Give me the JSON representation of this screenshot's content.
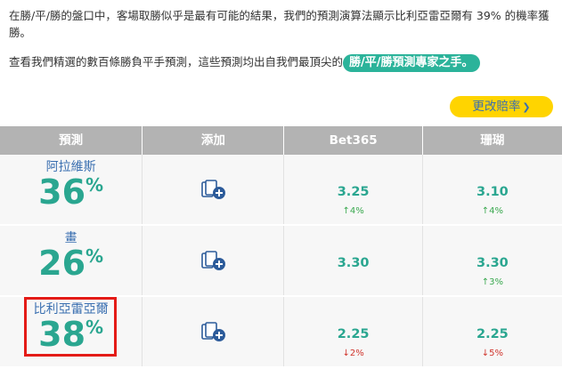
{
  "intro": {
    "line1": "在勝/平/勝的盤口中，客場取勝似乎是最有可能的結果，我們的預測演算法顯示比利亞雷亞爾有 39% 的機率獲勝。",
    "line2_prefix": "查看我們精選的數百條勝負平手預測，這些預測均出自我們最頂尖的",
    "pill": "勝/平/勝預測專家之手。"
  },
  "odds_button": {
    "label": "更改賠率",
    "icon": "chevron-down-icon"
  },
  "table": {
    "headers": [
      "預測",
      "添加",
      "Bet365",
      "珊瑚"
    ],
    "rows": [
      {
        "team": "阿拉維斯",
        "pct": "36",
        "sign": "%",
        "bet365": "3.25",
        "bet365_chg": "↑4%",
        "coral": "3.10",
        "coral_chg": "↑4%"
      },
      {
        "team": "畫",
        "pct": "26",
        "sign": "%",
        "bet365": "3.30",
        "bet365_chg": "",
        "coral": "3.30",
        "coral_chg": "↑3%"
      },
      {
        "team": "比利亞雷亞爾",
        "pct": "38",
        "sign": "%",
        "bet365": "2.25",
        "bet365_chg": "↓2%",
        "coral": "2.25",
        "coral_chg": "↓5%"
      }
    ]
  },
  "colors": {
    "accent": "#2aa690",
    "pill": "#2bb39a",
    "button": "#ffd400",
    "highlight": "#e41b17",
    "header": "#b3b3b3"
  }
}
